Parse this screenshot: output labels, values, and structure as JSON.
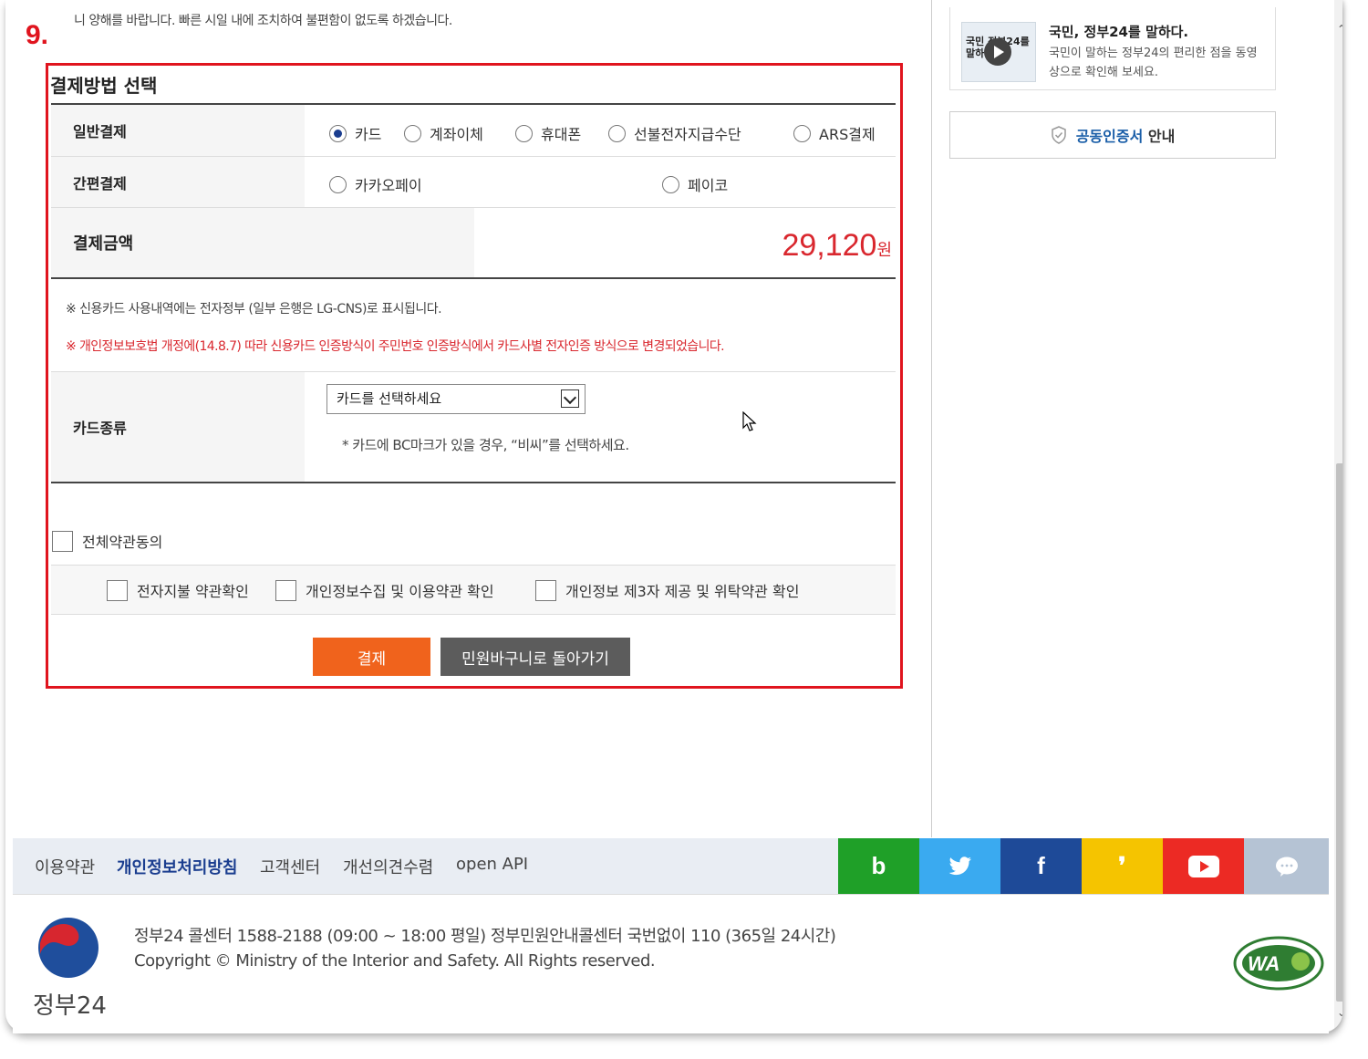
{
  "top_note": "니 양해를 바랍니다. 빠른 시일 내에 조치하여 불편함이 없도록 하겠습니다.",
  "step_label": "9.",
  "section_title": "결제방법 선택",
  "general_payment": {
    "label": "일반결제",
    "options": [
      "카드",
      "계좌이체",
      "휴대폰",
      "선불전자지급수단",
      "ARS결제"
    ],
    "selected": "카드"
  },
  "simple_payment": {
    "label": "간편결제",
    "options": [
      "카카오페이",
      "페이코"
    ]
  },
  "amount": {
    "label": "결제금액",
    "value": "29,120",
    "unit": "원"
  },
  "notes": {
    "note1": "※ 신용카드 사용내역에는 전자정부 (일부 은행은 LG-CNS)로 표시됩니다.",
    "note2": "※ 개인정보보호법 개정에(14.8.7) 따라 신용카드 인증방식이 주민번호 인증방식에서 카드사별 전자인증 방식으로 변경되었습니다."
  },
  "card_type": {
    "label": "카드종류",
    "select_value": "카드를 선택하세요",
    "hint": "* 카드에 BC마크가 있을 경우, “비씨”를 선택하세요."
  },
  "agreements": {
    "all": "전체약관동의",
    "items": [
      "전자지불 약관확인",
      "개인정보수집 및 이용약관 확인",
      "개인정보 제3자 제공 및 위탁약관 확인"
    ]
  },
  "buttons": {
    "pay": "결제",
    "back": "민원바구니로 돌아가기"
  },
  "sidebar": {
    "promo_thumb_text": "국민 정부24를 말하다",
    "promo_title": "국민, 정부24를 말하다.",
    "promo_desc": "국민이 말하는 정부24의 편리한 점을 동영상으로 확인해 보세요.",
    "cert_highlight": "공동인증서",
    "cert_rest": " 안내"
  },
  "footer_nav": [
    "이용약관",
    "개인정보처리방침",
    "고객센터",
    "개선의견수렴",
    "open API"
  ],
  "sns": [
    {
      "name": "blog",
      "glyph": "b",
      "color": "#1fa028"
    },
    {
      "name": "twitter",
      "glyph": "🐦",
      "color": "#3aaaf0"
    },
    {
      "name": "facebook",
      "glyph": "f",
      "color": "#1e4a98"
    },
    {
      "name": "kakaostory",
      "glyph": "❜",
      "color": "#f5c400"
    },
    {
      "name": "youtube",
      "glyph": "▶",
      "color": "#ec2a24"
    },
    {
      "name": "kakaotalk",
      "glyph": "…",
      "color": "#b5c3d4"
    }
  ],
  "footer": {
    "line1": "정부24 콜센터 1588-2188 (09:00 ~ 18:00 평일) 정부민원안내콜센터 국번없이 110 (365일 24시간)",
    "line2": "Copyright © Ministry of the Interior and Safety. All Rights reserved.",
    "logo_text": "정부24"
  }
}
